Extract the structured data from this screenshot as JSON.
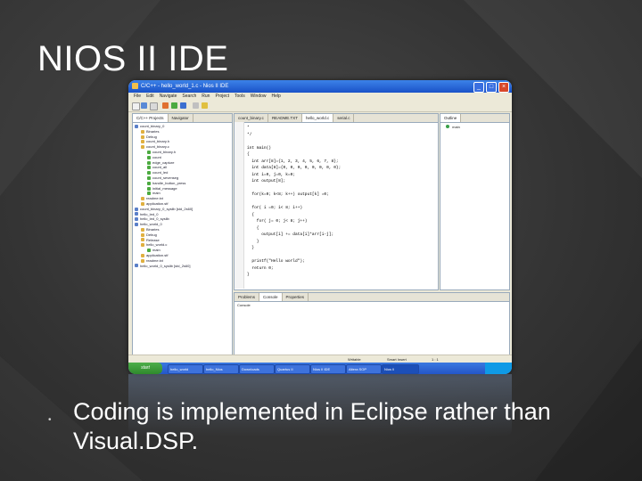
{
  "slide": {
    "title": "NIOS II IDE",
    "bullet": "Coding is implemented in Eclipse rather than Visual.DSP."
  },
  "window": {
    "title": "C/C++ - hello_world_1.c - Nios II IDE",
    "menu": [
      "File",
      "Edit",
      "Navigate",
      "Search",
      "Run",
      "Project",
      "Tools",
      "Window",
      "Help"
    ]
  },
  "left_panel": {
    "tabs": [
      "C/C++ Projects",
      "Navigator"
    ],
    "tree": [
      {
        "label": "count_binary_0",
        "indent": 0
      },
      {
        "label": "Binaries",
        "indent": 1
      },
      {
        "label": "Debug",
        "indent": 1
      },
      {
        "label": "count_binary.h",
        "indent": 1
      },
      {
        "label": "count_binary.c",
        "indent": 1
      },
      {
        "label": "count_binary.h",
        "indent": 2
      },
      {
        "label": "count",
        "indent": 2
      },
      {
        "label": "edge_capture",
        "indent": 2
      },
      {
        "label": "count_all",
        "indent": 2
      },
      {
        "label": "count_led",
        "indent": 2
      },
      {
        "label": "count_sevenseg",
        "indent": 2
      },
      {
        "label": "handle_button_press",
        "indent": 2
      },
      {
        "label": "initial_message",
        "indent": 2
      },
      {
        "label": "main",
        "indent": 2
      },
      {
        "label": "readme.txt",
        "indent": 1
      },
      {
        "label": "application.stf",
        "indent": 1
      },
      {
        "label": "count_binary_0_syslib [std_2s60]",
        "indent": 0
      },
      {
        "label": "hello_led_0",
        "indent": 0
      },
      {
        "label": "hello_led_0_syslib",
        "indent": 0
      },
      {
        "label": "hello_world_0",
        "indent": 0
      },
      {
        "label": "Binaries",
        "indent": 1
      },
      {
        "label": "Debug",
        "indent": 1
      },
      {
        "label": "Release",
        "indent": 1
      },
      {
        "label": "hello_world.c",
        "indent": 1
      },
      {
        "label": "main",
        "indent": 2
      },
      {
        "label": "application.stf",
        "indent": 1
      },
      {
        "label": "readme.txt",
        "indent": 1
      },
      {
        "label": "hello_world_0_syslib [std_2s60]",
        "indent": 0
      }
    ]
  },
  "editor": {
    "tabs": [
      "count_binary.c",
      "README.TXT",
      "hello_world.c",
      "serial.c"
    ],
    "code": [
      "*",
      "*/",
      "",
      "int main()",
      "{",
      "  int arr[8]={1, 2, 3, 4, 5, 6, 7, 8};",
      "  int data[8]={0, 0, 0, 0, 0, 0, 0, 0};",
      "  int i=0, j=0, k=0;",
      "  int output[8];",
      "",
      "  for(k=0; k<8; k++) output[k] =0;",
      "",
      "  for( i =0; i< 8; i++)",
      "  {",
      "    for( j= 0; j< 8; j++)",
      "    {",
      "      output[i] += data[i]*arr[i-j];",
      "    }",
      "  }",
      "",
      "  printf(\"Hello world\");",
      "  return 0;",
      "}"
    ]
  },
  "outline": {
    "tab": "Outline",
    "items": [
      "main"
    ]
  },
  "console": {
    "tabs": [
      "Problems",
      "Console",
      "Properties"
    ],
    "text": "Console"
  },
  "status": {
    "writable": "Writable",
    "insert": "Smart Insert",
    "position": "1 : 1"
  },
  "taskbar": {
    "start": "start",
    "tasks": [
      "hello_world",
      "hello_Nios",
      "Downloads",
      "Quartus II",
      "Nios II IDE",
      "Altera SOP",
      "Nios II"
    ]
  }
}
